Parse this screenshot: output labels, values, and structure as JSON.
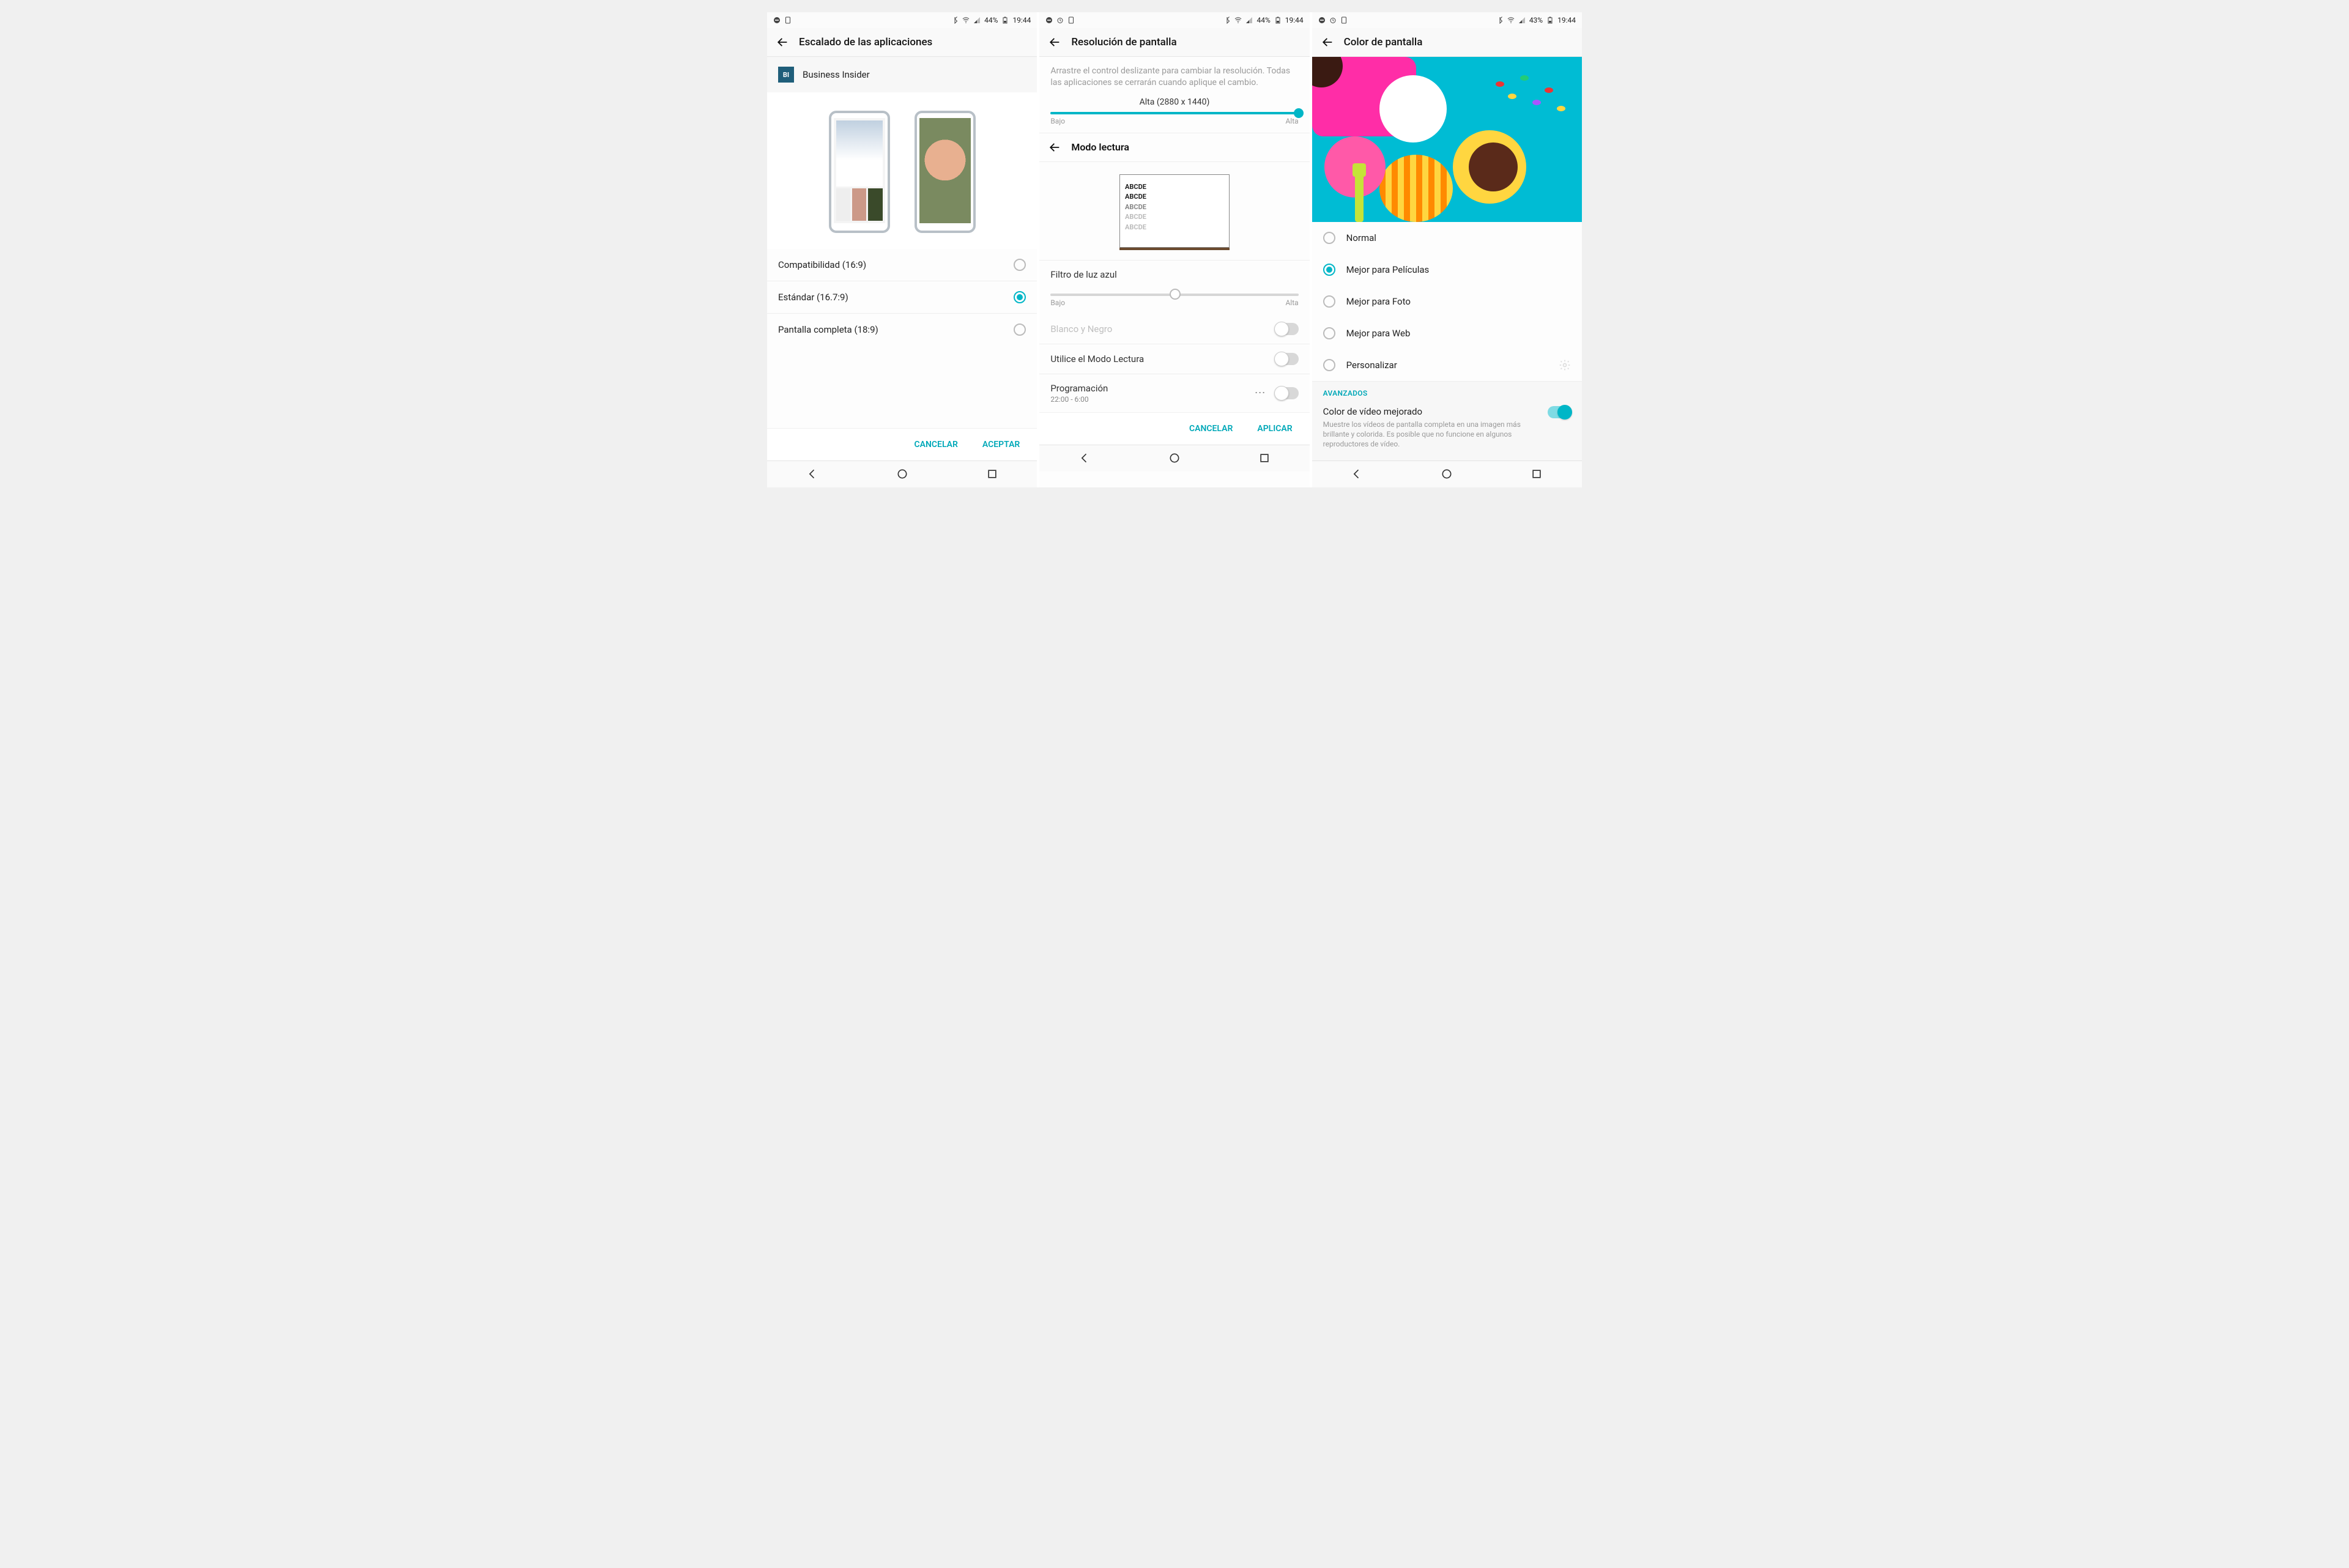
{
  "pane1": {
    "status": {
      "battery": "44%",
      "time": "19:44"
    },
    "title": "Escalado de las aplicaciones",
    "app": {
      "icon": "BI",
      "name": "Business Insider"
    },
    "options": [
      {
        "label": "Compatibilidad (16:9)",
        "checked": false
      },
      {
        "label": "Estándar (16.7:9)",
        "checked": true
      },
      {
        "label": "Pantalla completa (18:9)",
        "checked": false
      }
    ],
    "actions": {
      "cancel": "CANCELAR",
      "accept": "ACEPTAR"
    }
  },
  "pane2": {
    "status": {
      "battery": "44%",
      "time": "19:44"
    },
    "title": "Resolución de pantalla",
    "desc": "Arrastre el control deslizante para cambiar la resolución. Todas las aplicaciones se cerrarán cuando aplique el cambio.",
    "resolution": {
      "value_label": "Alta (2880 x 1440)",
      "low": "Bajo",
      "high": "Alta"
    },
    "sub_title": "Modo lectura",
    "book_lines": [
      "ABCDE",
      "ABCDE",
      "ABCDE",
      "ABCDE",
      "ABCDE"
    ],
    "blue_filter": {
      "title": "Filtro de luz azul",
      "low": "Bajo",
      "high": "Alta"
    },
    "bw": {
      "label": "Blanco y Negro"
    },
    "use_reading": {
      "label": "Utilice el Modo Lectura"
    },
    "schedule": {
      "label": "Programación",
      "sub": "22:00 - 6:00"
    },
    "actions": {
      "cancel": "CANCELAR",
      "apply": "APLICAR"
    }
  },
  "pane3": {
    "status": {
      "battery": "43%",
      "time": "19:44"
    },
    "title": "Color de pantalla",
    "options": [
      {
        "label": "Normal",
        "checked": false
      },
      {
        "label": "Mejor para Películas",
        "checked": true
      },
      {
        "label": "Mejor para Foto",
        "checked": false
      },
      {
        "label": "Mejor para Web",
        "checked": false
      },
      {
        "label": "Personalizar",
        "checked": false,
        "gear": true
      }
    ],
    "advanced": {
      "section": "AVANZADOS",
      "title": "Color de vídeo mejorado",
      "desc": "Muestre los vídeos de pantalla completa en una imagen más brillante y colorida. Es posible que no funcione en algunos reproductores de vídeo.",
      "enabled": true
    }
  }
}
